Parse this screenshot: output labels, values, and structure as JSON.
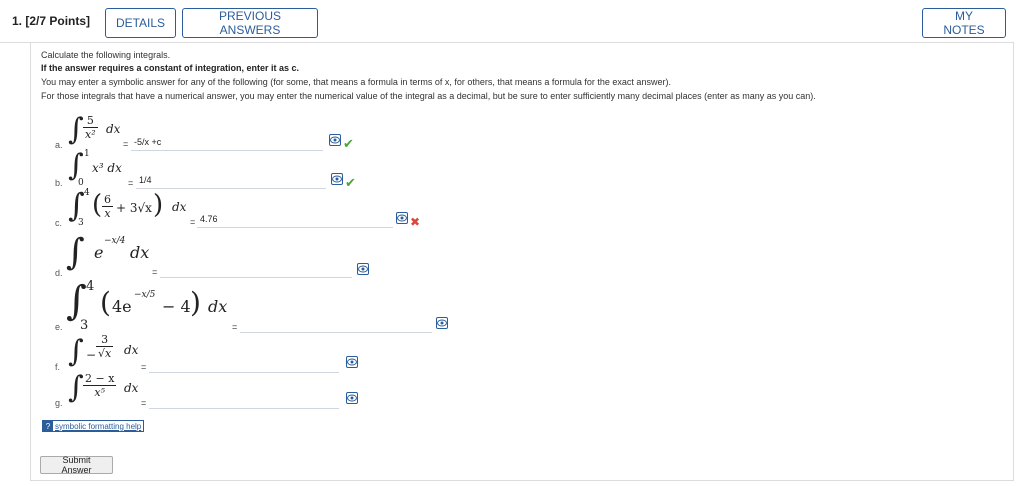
{
  "header": {
    "question_number": "1.",
    "points": "[2/7 Points]",
    "details_label": "DETAILS",
    "previous_answers_label": "PREVIOUS ANSWERS",
    "my_notes_label": "MY NOTES"
  },
  "instructions": {
    "line1": "Calculate the following integrals.",
    "line2": "If the answer requires a constant of integration, enter it as c.",
    "line3": "You may enter a symbolic answer for any of the following (for some, that means a formula in terms of x, for others, that means a formula for the exact answer).",
    "line4": "For those integrals that have a numerical answer, you may enter the numerical value of the integral as a decimal, but be sure to enter sufficiently many decimal places (enter as many as you can)."
  },
  "parts": {
    "a": {
      "label": "a.",
      "integrand_num": "5",
      "integrand_den": "x²",
      "dx": "dx",
      "answer": "-5/x +c",
      "status": "correct"
    },
    "b": {
      "label": "b.",
      "lower": "0",
      "upper": "1",
      "integrand": "x³ dx",
      "answer": "1/4",
      "status": "correct"
    },
    "c": {
      "label": "c.",
      "lower": "3",
      "upper": "4",
      "frac_num": "6",
      "frac_den": "x",
      "rest": "+ 3√x",
      "dx": "dx",
      "answer": "4.76",
      "status": "incorrect"
    },
    "d": {
      "label": "d.",
      "integrand": "e",
      "exponent": "−x/4",
      "dx": "dx",
      "answer": "",
      "status": "none"
    },
    "e": {
      "label": "e.",
      "lower": "3",
      "upper": "4",
      "integrand_a": "4e",
      "exponent": "−x/5",
      "integrand_b": "− 4",
      "dx": "dx",
      "answer": "",
      "status": "none"
    },
    "f": {
      "label": "f.",
      "sign": "−",
      "frac_num": "3",
      "frac_den": "√x",
      "dx": "dx",
      "answer": "",
      "status": "none"
    },
    "g": {
      "label": "g.",
      "frac_num": "2 − x",
      "frac_den": "x⁵",
      "dx": "dx",
      "answer": "",
      "status": "none"
    }
  },
  "equals": "=",
  "icons": {
    "preview": "eye-preview-icon",
    "correct": "check-icon",
    "incorrect": "cross-icon",
    "help": "help-icon"
  },
  "help_link_label": "symbolic formatting help",
  "submit_label": "Submit Answer",
  "colors": {
    "accent": "#2b5d9b",
    "correct": "#4aa43a",
    "incorrect": "#d9483b"
  }
}
